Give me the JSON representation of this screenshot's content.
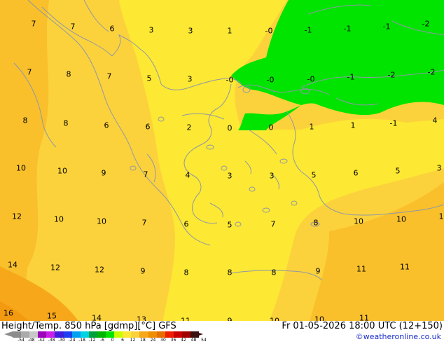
{
  "footer": {
    "title_left": "Height/Temp. 850 hPa [gdmp][°C] GFS",
    "title_right": "Fr 01-05-2026 18:00 UTC (12+150)",
    "credit": "©weatheronline.co.uk"
  },
  "colors": {
    "background_light_orange": "#fcd23c",
    "inner_orange": "#f9c02c",
    "yellow": "#fde833",
    "deep_orange": "#f7a81a",
    "green": "#00e400",
    "coastline": "#8f98a6"
  },
  "legend": {
    "colors": [
      "#8c8c8c",
      "#aaaaaa",
      "#c8c8c8",
      "#9c00bc",
      "#c81ee6",
      "#3c1edc",
      "#1e3cf0",
      "#00a0f0",
      "#00d2e6",
      "#00a03c",
      "#00b400",
      "#00e400",
      "#c8ff00",
      "#fde833",
      "#fcd23c",
      "#f7a81a",
      "#f08c00",
      "#e66e00",
      "#f01e00",
      "#c80000",
      "#a00000",
      "#3a1010"
    ],
    "ticks": [
      "-54",
      "-48",
      "-42",
      "-38",
      "-30",
      "-24",
      "-18",
      "-12",
      "-6",
      "0",
      "6",
      "12",
      "18",
      "24",
      "30",
      "36",
      "42",
      "48",
      "54"
    ]
  },
  "values": [
    {
      "t": "7"
    },
    {
      "t": "7"
    },
    {
      "t": "6"
    },
    {
      "t": "3"
    },
    {
      "t": "3"
    },
    {
      "t": "1"
    },
    {
      "t": "-0"
    },
    {
      "t": "-1"
    },
    {
      "t": "-1"
    },
    {
      "t": "-1"
    },
    {
      "t": "-2"
    },
    {
      "t": "7"
    },
    {
      "t": "8"
    },
    {
      "t": "7"
    },
    {
      "t": "5"
    },
    {
      "t": "3"
    },
    {
      "t": "-0"
    },
    {
      "t": "-0"
    },
    {
      "t": "-0"
    },
    {
      "t": "-1"
    },
    {
      "t": "-2"
    },
    {
      "t": "-2"
    },
    {
      "t": "8"
    },
    {
      "t": "8"
    },
    {
      "t": "6"
    },
    {
      "t": "6"
    },
    {
      "t": "2"
    },
    {
      "t": "0"
    },
    {
      "t": "0"
    },
    {
      "t": "1"
    },
    {
      "t": "1"
    },
    {
      "t": "-1"
    },
    {
      "t": "4"
    },
    {
      "t": "10"
    },
    {
      "t": "10"
    },
    {
      "t": "9"
    },
    {
      "t": "7"
    },
    {
      "t": "4"
    },
    {
      "t": "3"
    },
    {
      "t": "3"
    },
    {
      "t": "5"
    },
    {
      "t": "6"
    },
    {
      "t": "5"
    },
    {
      "t": "3"
    },
    {
      "t": "12"
    },
    {
      "t": "10"
    },
    {
      "t": "10"
    },
    {
      "t": "7"
    },
    {
      "t": "6"
    },
    {
      "t": "5"
    },
    {
      "t": "7"
    },
    {
      "t": "8"
    },
    {
      "t": "10"
    },
    {
      "t": "10"
    },
    {
      "t": "1"
    },
    {
      "t": "14"
    },
    {
      "t": "12"
    },
    {
      "t": "12"
    },
    {
      "t": "9"
    },
    {
      "t": "8"
    },
    {
      "t": "8"
    },
    {
      "t": "8"
    },
    {
      "t": "9"
    },
    {
      "t": "11"
    },
    {
      "t": "11"
    },
    {
      "t": "16"
    },
    {
      "t": "15"
    },
    {
      "t": "14"
    },
    {
      "t": "13"
    },
    {
      "t": "11"
    },
    {
      "t": "9"
    },
    {
      "t": "10"
    },
    {
      "t": "10"
    },
    {
      "t": "11"
    }
  ]
}
